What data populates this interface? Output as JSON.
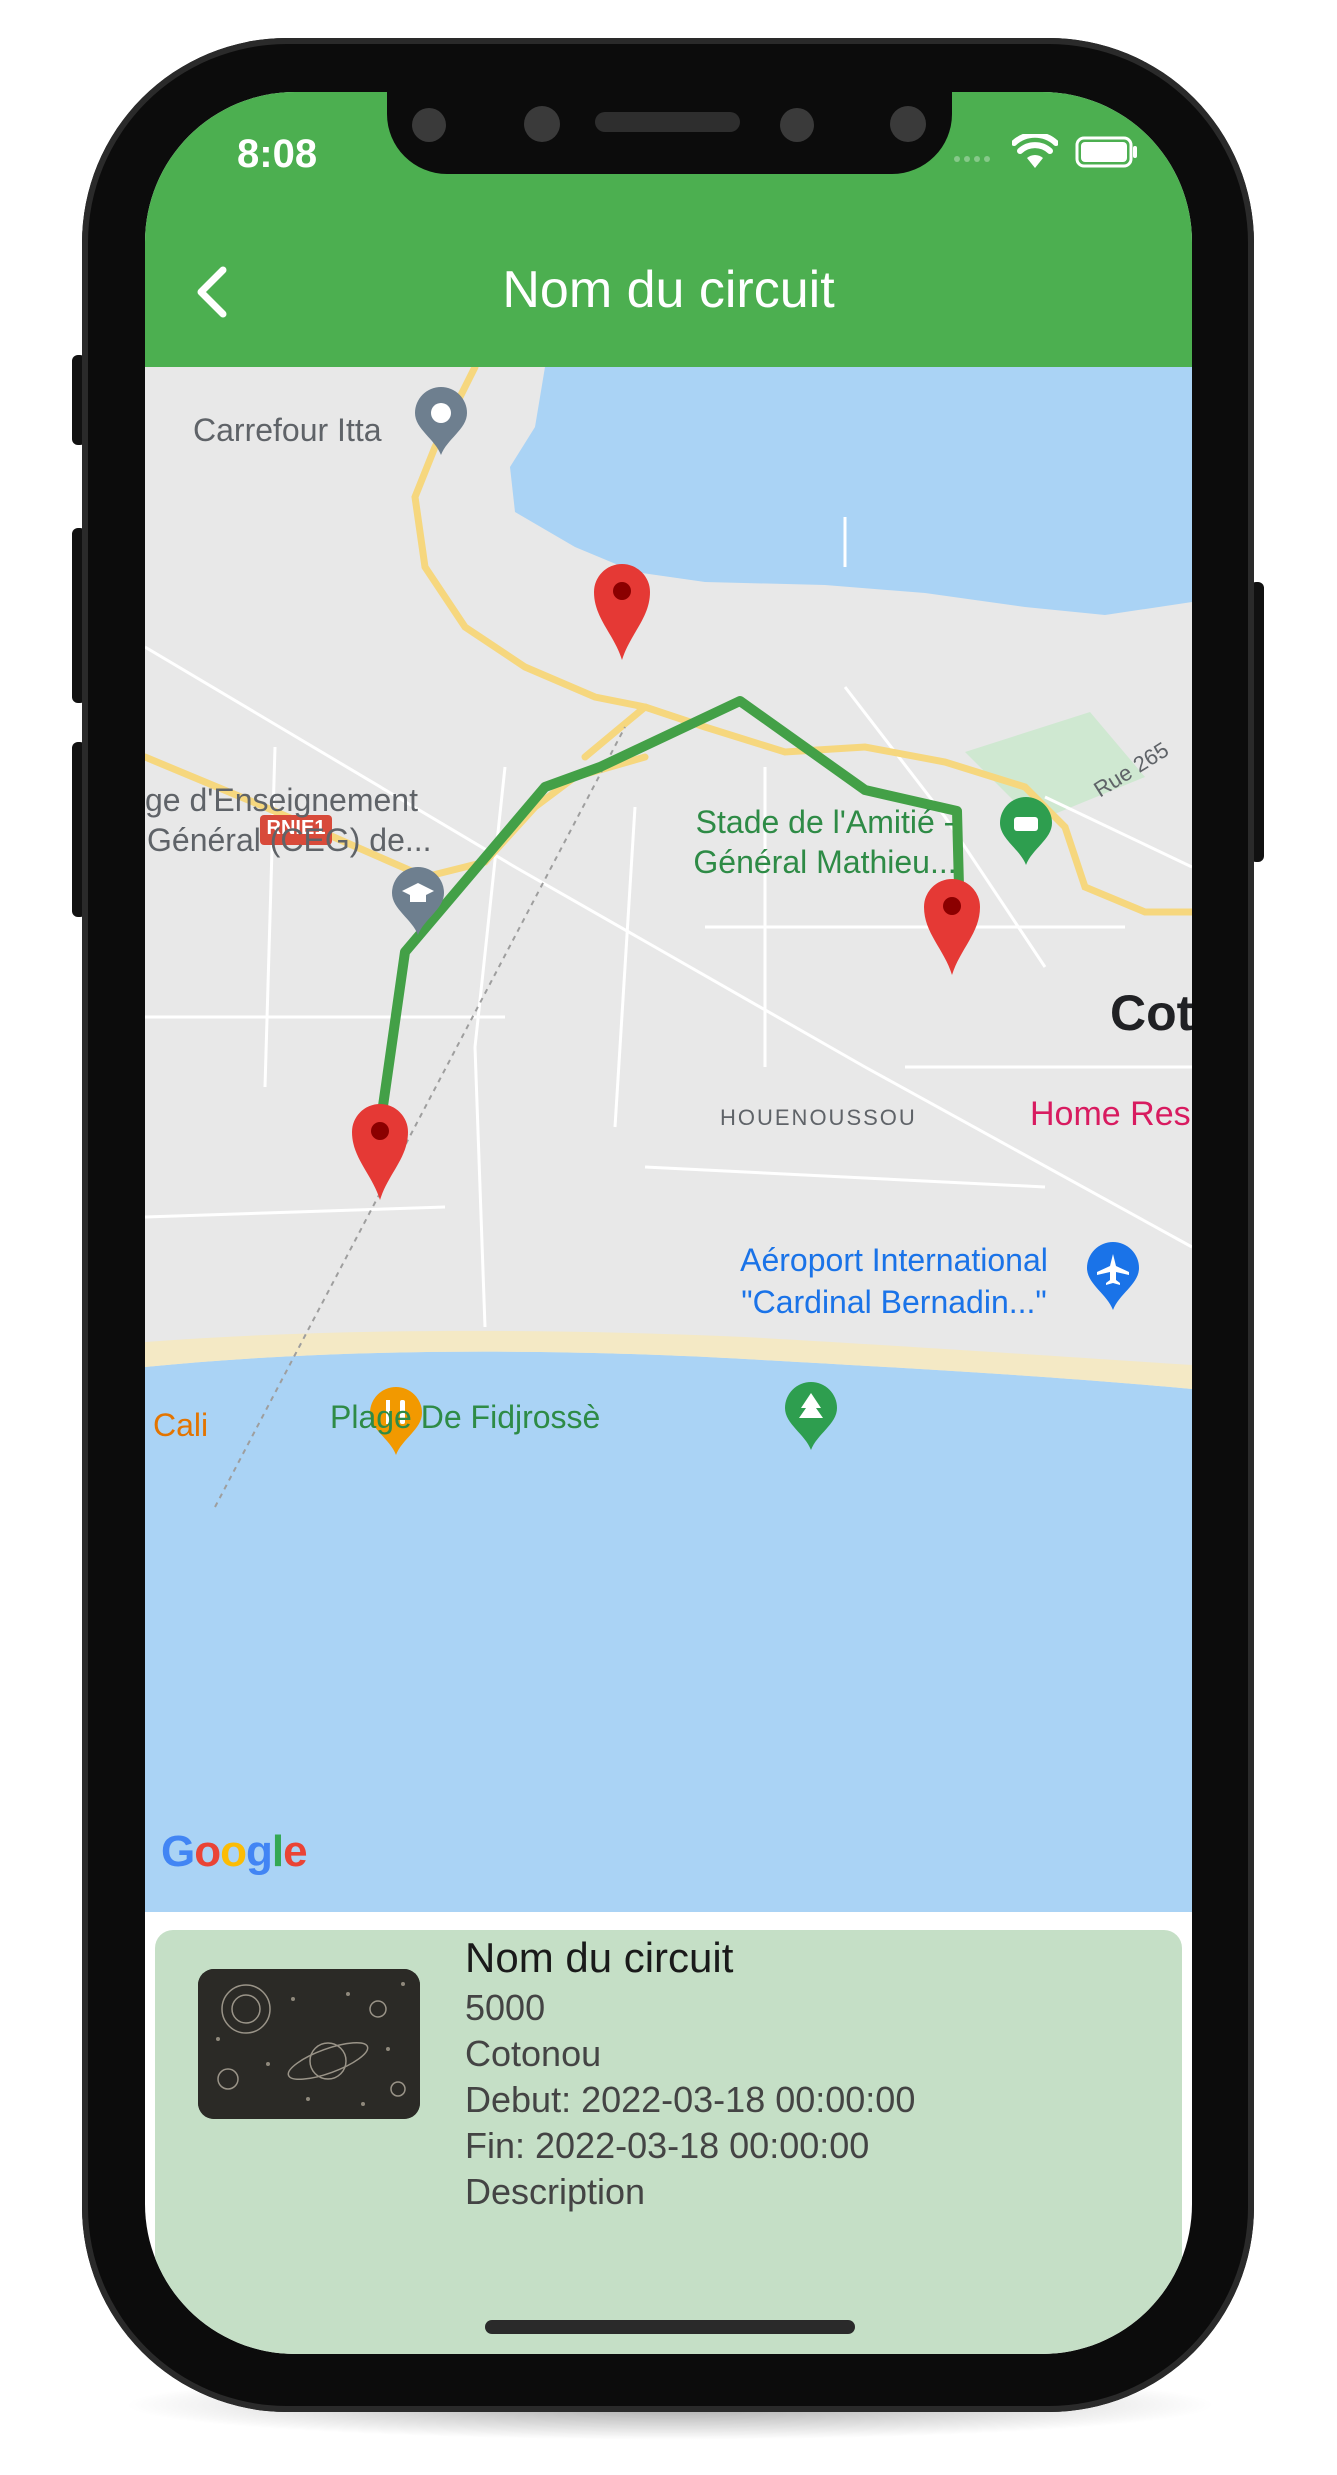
{
  "status_bar": {
    "time": "8:08"
  },
  "app_bar": {
    "title": "Nom du circuit",
    "back_icon": "chevron-left-icon"
  },
  "map": {
    "pois": {
      "carrefour": "Carrefour Itta",
      "ceg_line1": "ge d'Enseignement",
      "ceg_line2": "Général (CEG) de...",
      "road_badge": "RNIE1",
      "stade_line1": "Stade de l'Amitié -",
      "stade_line2": "Général Mathieu...",
      "rue": "Rue 265",
      "city": "Cot",
      "neighborhood": "HOUENOUSSOU",
      "home_res": "Home Res",
      "airport_line1": "Aéroport International",
      "airport_line2": "\"Cardinal Bernadin...\"",
      "cali": "Cali",
      "plage": "Plage De Fidjrossè"
    },
    "attribution": "Google",
    "colors": {
      "route": "#43a047",
      "marker": "#e53935",
      "water": "#aad3f5",
      "land": "#e8e8e8",
      "road": "#f6d77e"
    }
  },
  "circuit": {
    "name": "Nom du circuit",
    "price": "5000",
    "city": "Cotonou",
    "start": "Debut: 2022-03-18 00:00:00",
    "end": "Fin: 2022-03-18 00:00:00",
    "description": "Description"
  },
  "colors": {
    "primary": "#4caf50",
    "card_bg": "#c5dfc6"
  }
}
